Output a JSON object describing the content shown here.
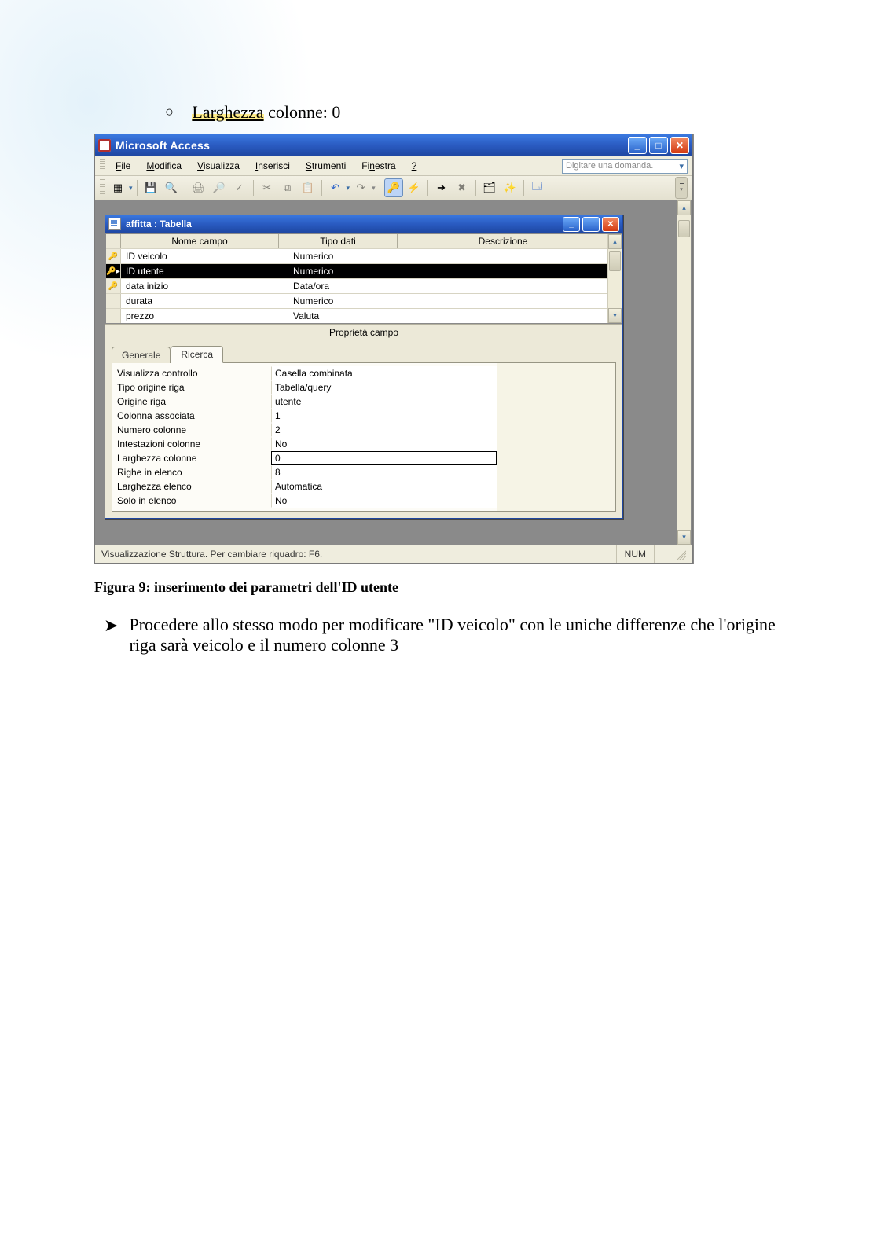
{
  "doc": {
    "bullet_text_a": "Larghezza",
    "bullet_text_b": " colonne: 0",
    "figure_caption": "Figura 9: inserimento dei parametri dell'ID utente",
    "arrow_text": "Procedere allo stesso modo per modificare \"ID veicolo\" con le uniche differenze che l'origine riga sarà veicolo e il numero colonne 3"
  },
  "app": {
    "title": "Microsoft Access",
    "menus": {
      "file": "File",
      "modifica": "Modifica",
      "visualizza": "Visualizza",
      "inserisci": "Inserisci",
      "strumenti": "Strumenti",
      "finestra": "Finestra",
      "help": "?"
    },
    "search_placeholder": "Digitare una domanda.",
    "status_text": "Visualizzazione Struttura. Per cambiare riquadro: F6.",
    "status_numlock": "NUM"
  },
  "inner": {
    "title": "affitta : Tabella",
    "headers": {
      "name": "Nome campo",
      "type": "Tipo dati",
      "desc": "Descrizione"
    },
    "rows": [
      {
        "key": true,
        "selected": false,
        "name": "ID veicolo",
        "type": "Numerico"
      },
      {
        "key": true,
        "selected": true,
        "name": "ID utente",
        "type": "Numerico"
      },
      {
        "key": true,
        "selected": false,
        "name": "data inizio",
        "type": "Data/ora"
      },
      {
        "key": false,
        "selected": false,
        "name": "durata",
        "type": "Numerico"
      },
      {
        "key": false,
        "selected": false,
        "name": "prezzo",
        "type": "Valuta"
      }
    ],
    "prop_caption": "Proprietà campo",
    "tabs": {
      "general": "Generale",
      "lookup": "Ricerca"
    },
    "props": [
      {
        "label": "Visualizza controllo",
        "value": "Casella combinata",
        "editing": false
      },
      {
        "label": "Tipo origine riga",
        "value": "Tabella/query",
        "editing": false
      },
      {
        "label": "Origine riga",
        "value": "utente",
        "editing": false
      },
      {
        "label": "Colonna associata",
        "value": "1",
        "editing": false
      },
      {
        "label": "Numero colonne",
        "value": "2",
        "editing": false
      },
      {
        "label": "Intestazioni colonne",
        "value": "No",
        "editing": false
      },
      {
        "label": "Larghezza colonne",
        "value": "0",
        "editing": true
      },
      {
        "label": "Righe in elenco",
        "value": "8",
        "editing": false
      },
      {
        "label": "Larghezza elenco",
        "value": "Automatica",
        "editing": false
      },
      {
        "label": "Solo in elenco",
        "value": "No",
        "editing": false
      }
    ]
  }
}
